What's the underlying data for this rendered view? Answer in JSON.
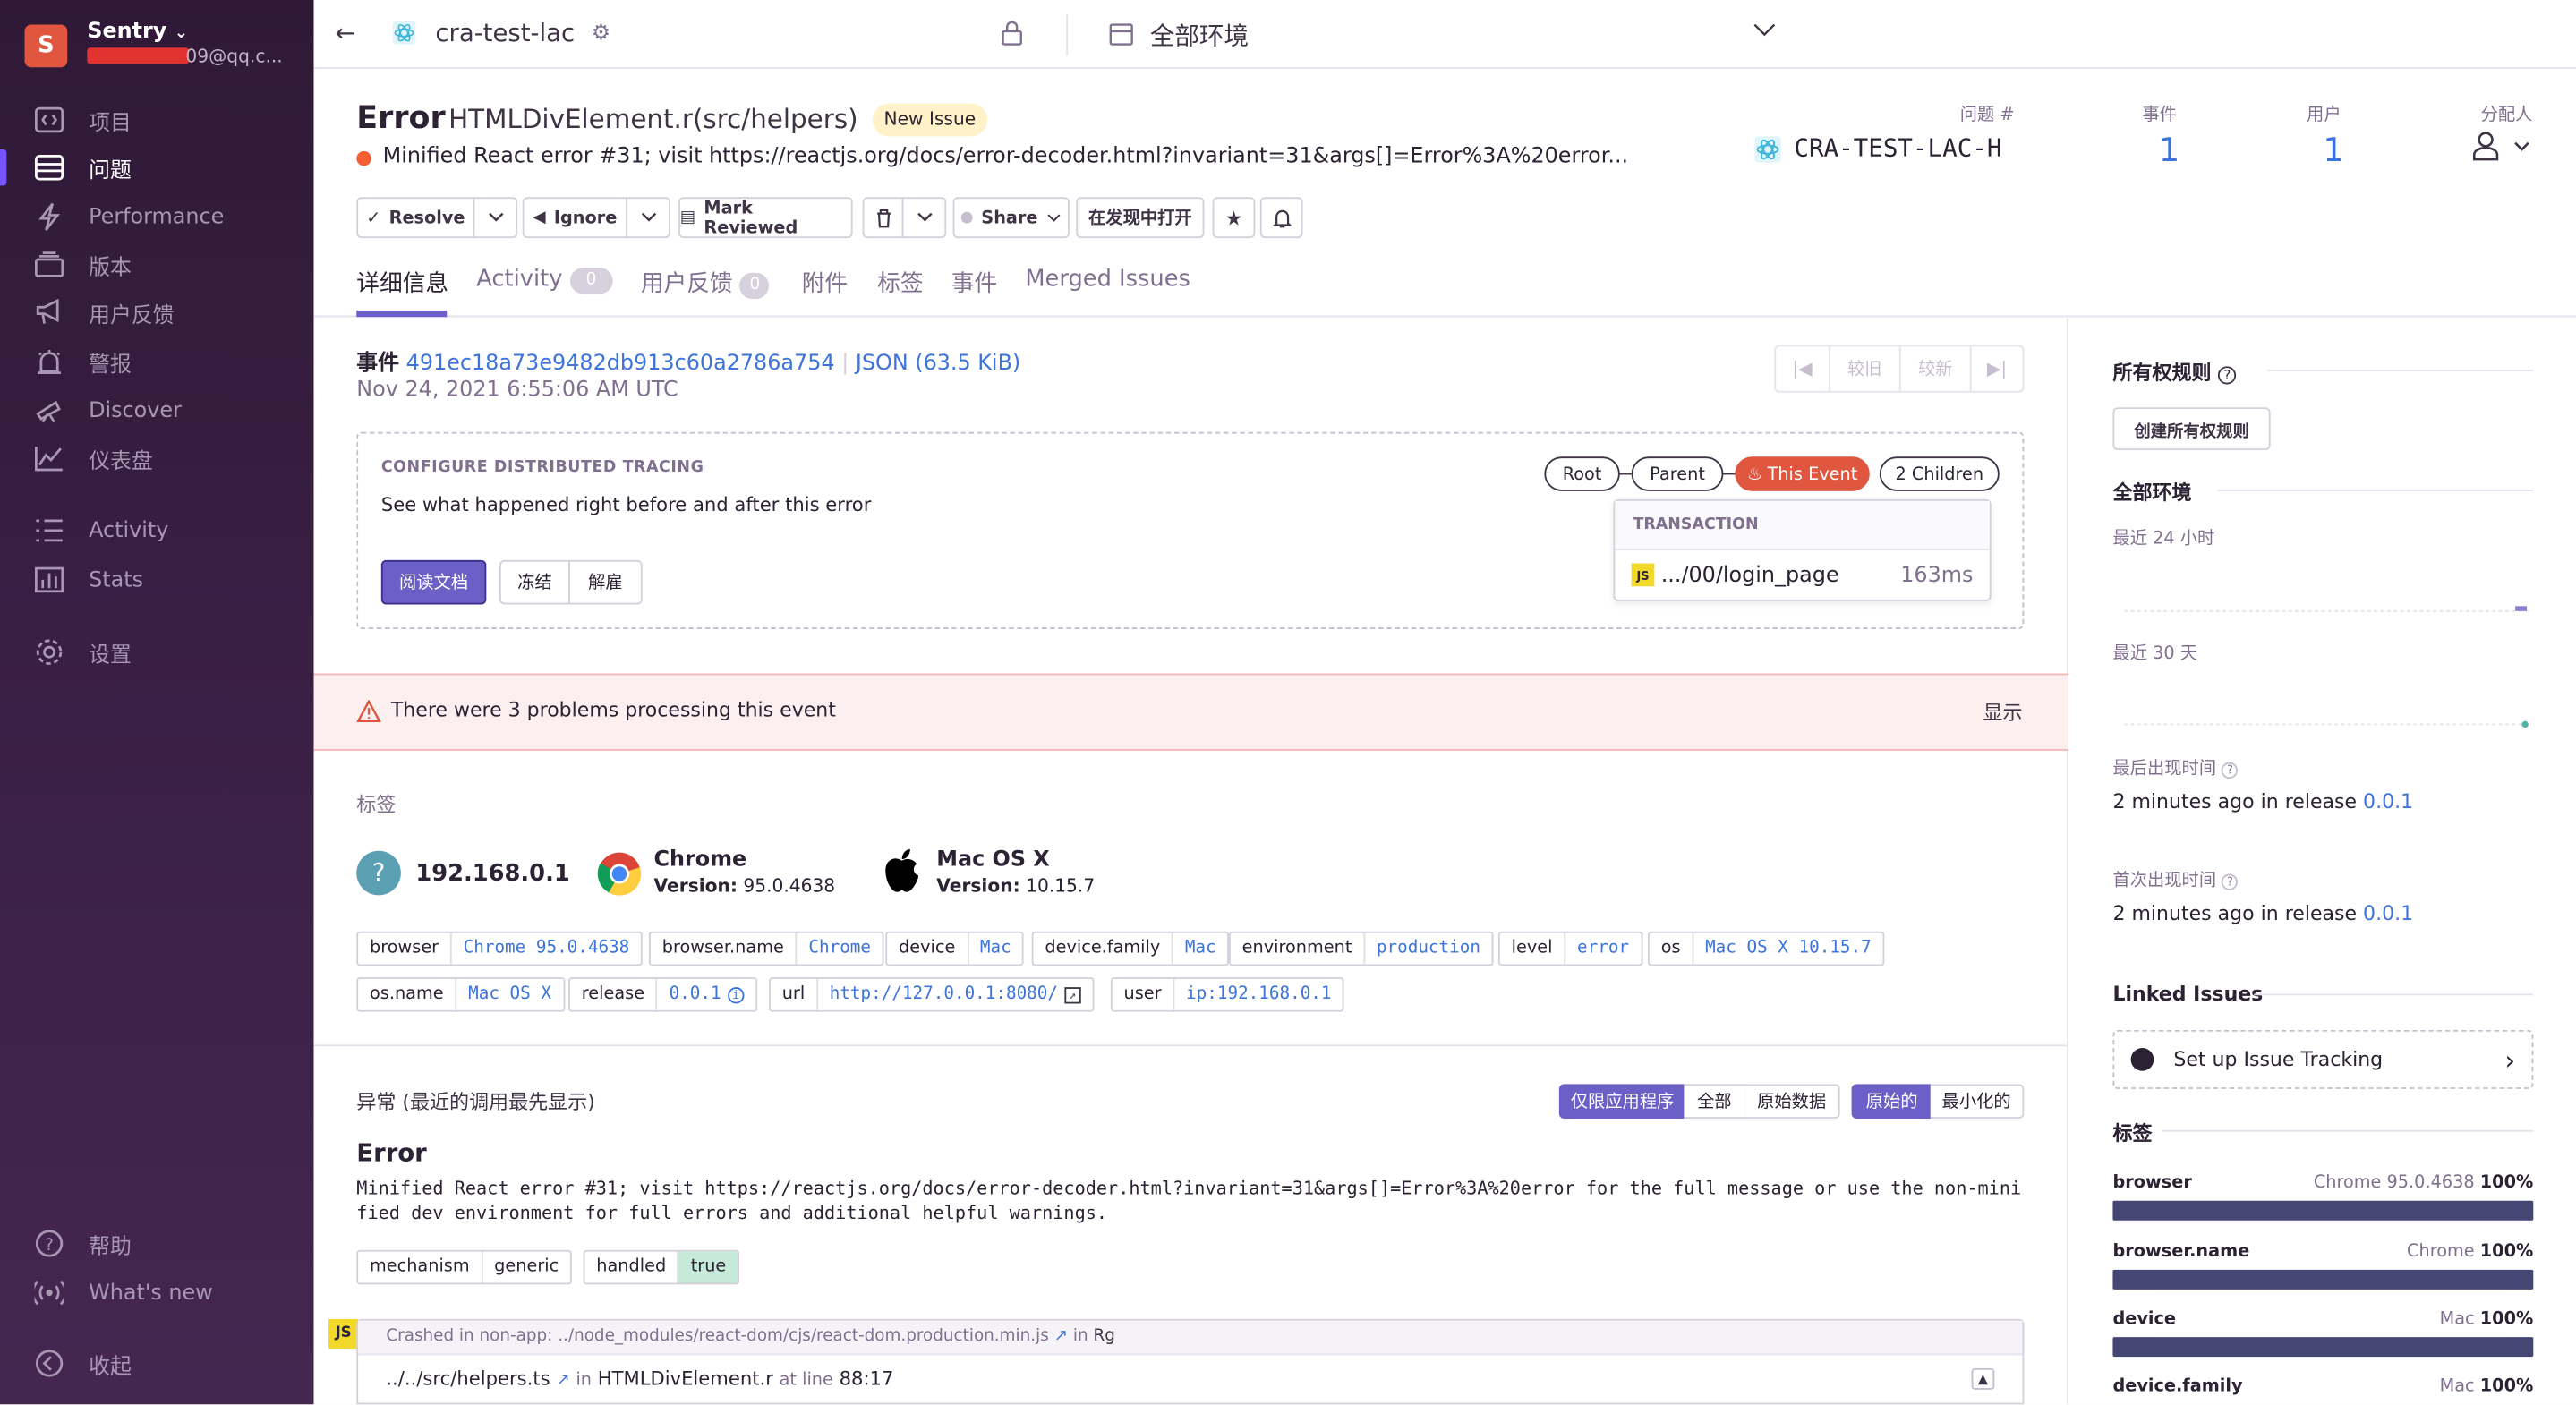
{
  "sidebar": {
    "org_initial": "S",
    "org_name": "Sentry",
    "org_email": "09@qq.c...",
    "items": [
      {
        "label": "项目"
      },
      {
        "label": "问题"
      },
      {
        "label": "Performance"
      },
      {
        "label": "版本"
      },
      {
        "label": "用户反馈"
      },
      {
        "label": "警报"
      },
      {
        "label": "Discover"
      },
      {
        "label": "仪表盘"
      },
      {
        "label": "Activity"
      },
      {
        "label": "Stats"
      },
      {
        "label": "设置"
      }
    ],
    "bottom": {
      "help": "帮助",
      "whats_new": "What's new",
      "collapse": "收起"
    }
  },
  "topbar": {
    "project": "cra-test-lac",
    "environment": "全部环境"
  },
  "issue": {
    "title": "Error",
    "culprit": "HTMLDivElement.r(src/helpers)",
    "badge": "New Issue",
    "message": "Minified React error #31; visit https://reactjs.org/docs/error-decoder.html?invariant=31&args[]=Error%3A%20error...",
    "stats": {
      "issue_label": "问题 #",
      "issue_id": "CRA-TEST-LAC-H",
      "events_label": "事件",
      "events": "1",
      "users_label": "用户",
      "users": "1",
      "assignee_label": "分配人"
    }
  },
  "actions": {
    "resolve": "Resolve",
    "ignore": "Ignore",
    "mark_reviewed": "Mark Reviewed",
    "share": "Share",
    "open_in_discover": "在发现中打开"
  },
  "tabs": [
    {
      "label": "详细信息"
    },
    {
      "label": "Activity",
      "count": "0"
    },
    {
      "label": "用户反馈",
      "count": "0"
    },
    {
      "label": "附件"
    },
    {
      "label": "标签"
    },
    {
      "label": "事件"
    },
    {
      "label": "Merged Issues"
    }
  ],
  "event": {
    "label": "事件",
    "id": "491ec18a73e9482db913c60a2786a754",
    "json": "JSON (63.5 KiB)",
    "date": "Nov 24, 2021 6:55:06 AM UTC",
    "nav": {
      "older": "较旧",
      "newer": "较新"
    }
  },
  "tracing": {
    "heading": "CONFIGURE DISTRIBUTED TRACING",
    "text": "See what happened right before and after this error",
    "read_docs": "阅读文档",
    "snooze": "冻结",
    "dismiss": "解雇",
    "pills": {
      "root": "Root",
      "parent": "Parent",
      "this_event": "This Event",
      "children": "2 Children"
    },
    "transaction_label": "TRANSACTION",
    "transaction_name": ".../00/login_page",
    "transaction_duration": "163ms"
  },
  "problems": {
    "text": "There were 3 problems processing this event",
    "show": "显示"
  },
  "tags_section": {
    "title": "标签",
    "summary": [
      {
        "title": "192.168.0.1"
      },
      {
        "title": "Chrome",
        "version_label": "Version:",
        "version": "95.0.4638"
      },
      {
        "title": "Mac OS X",
        "version_label": "Version:",
        "version": "10.15.7"
      }
    ],
    "tags": [
      {
        "key": "browser",
        "value": "Chrome 95.0.4638"
      },
      {
        "key": "browser.name",
        "value": "Chrome"
      },
      {
        "key": "device",
        "value": "Mac"
      },
      {
        "key": "device.family",
        "value": "Mac"
      },
      {
        "key": "environment",
        "value": "production"
      },
      {
        "key": "level",
        "value": "error"
      },
      {
        "key": "os",
        "value": "Mac OS X 10.15.7"
      },
      {
        "key": "os.name",
        "value": "Mac OS X"
      },
      {
        "key": "release",
        "value": "0.0.1"
      },
      {
        "key": "url",
        "value": "http://127.0.0.1:8080/"
      },
      {
        "key": "user",
        "value": "ip:192.168.0.1"
      }
    ]
  },
  "exception": {
    "title": "异常 (最近的调用最先显示)",
    "toggles": [
      "仅限应用程序",
      "全部",
      "原始数据",
      "原始的",
      "最小化的"
    ],
    "type": "Error",
    "value": "Minified React error #31; visit https://reactjs.org/docs/error-decoder.html?invariant=31&args[]=Error%3A%20error for the full message or use the non-minified dev environment for full errors and additional helpful warnings.",
    "mechanism": [
      {
        "key": "mechanism",
        "value": "generic"
      },
      {
        "key": "handled",
        "value": "true"
      }
    ],
    "crashed": {
      "prefix": "Crashed in non-app:",
      "path": "../node_modules/react-dom/cjs/react-dom.production.min.js",
      "in": "in",
      "fn": "Rg"
    },
    "frame": {
      "path": "../../src/helpers.ts",
      "in": "in",
      "fn": "HTMLDivElement.r",
      "at": "at line",
      "line": "88:17"
    },
    "platform_badge": "JS"
  },
  "right": {
    "ownership_title": "所有权规则",
    "create_ownership": "创建所有权规则",
    "env_title": "全部环境",
    "last24": "最近 24 小时",
    "last30": "最近 30 天",
    "last_seen_label": "最后出现时间",
    "last_seen": "2 minutes ago",
    "first_seen_label": "首次出现时间",
    "first_seen": "2 minutes ago",
    "in_release": "in release",
    "release": "0.0.1",
    "linked_issues_title": "Linked Issues",
    "setup_tracking": "Set up Issue Tracking",
    "tags_title": "标签",
    "tag_bars": [
      {
        "key": "browser",
        "value": "Chrome 95.0.4638",
        "pct": "100%"
      },
      {
        "key": "browser.name",
        "value": "Chrome",
        "pct": "100%"
      },
      {
        "key": "device",
        "value": "Mac",
        "pct": "100%"
      },
      {
        "key": "device.family",
        "value": "Mac",
        "pct": "100%"
      }
    ]
  },
  "colors": {
    "accent": "#6c5fc7",
    "link": "#3d74db",
    "error": "#e1563e",
    "bar": "#444674",
    "alert_bg": "#fcefef"
  }
}
